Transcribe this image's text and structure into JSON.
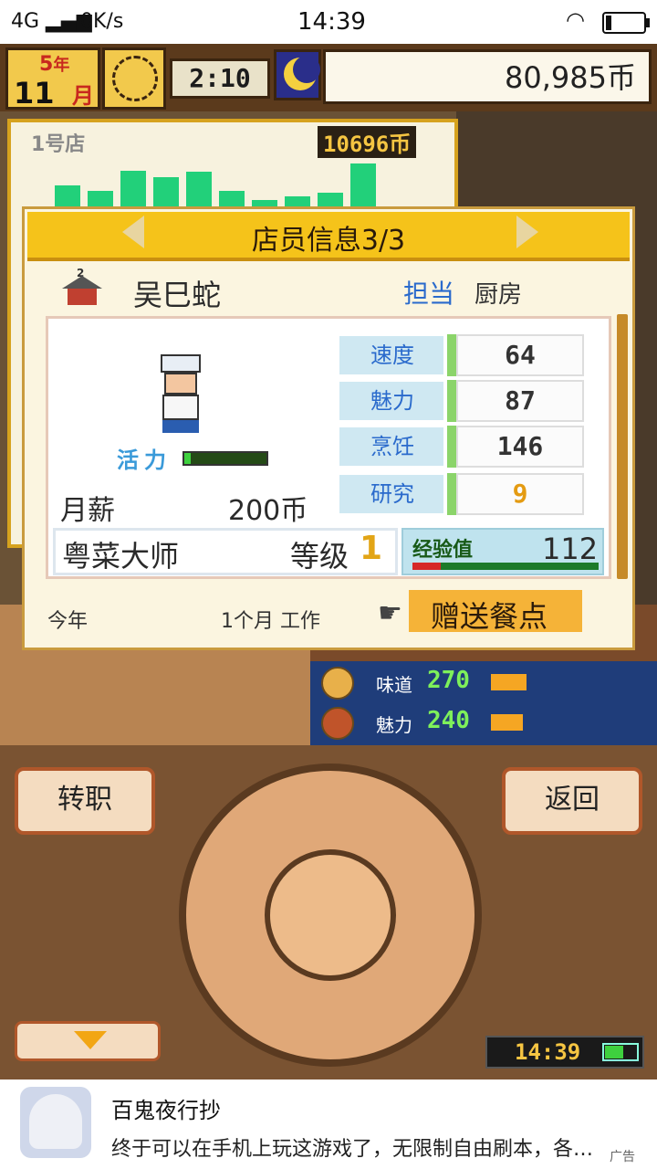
{
  "status_bar": {
    "signal": "4G",
    "net_speed": "0K/s",
    "time": "14:39"
  },
  "hud": {
    "date_month_year_num": "5",
    "date_year_unit": "年",
    "date_month_num": "11",
    "date_month_unit": "月",
    "game_time": "2:10",
    "money": "80,985币"
  },
  "store_panel": {
    "store_label": "1号店",
    "store_value": "10696币",
    "bars": [
      0.45,
      0.35,
      0.72,
      0.6,
      0.7,
      0.35,
      0.18,
      0.25,
      0.32,
      0.85
    ]
  },
  "dialog": {
    "title": "店员信息3/3",
    "store_number": "2",
    "staff_name": "吴巳蛇",
    "role_label": "担当",
    "role_value": "厨房",
    "vital_label": "活力",
    "vital_level": 0.08,
    "salary_label": "月薪",
    "salary_value": "200币",
    "stats": [
      {
        "label": "速度",
        "value": "64"
      },
      {
        "label": "魅力",
        "value": "87"
      },
      {
        "label": "烹饪",
        "value": "146"
      },
      {
        "label": "研究",
        "value": "9"
      }
    ],
    "skill_title": "粤菜大师",
    "level_label": "等级",
    "level_value": "1",
    "exp_label": "经验值",
    "exp_value": "112",
    "exp_progress": 0.15,
    "year_label": "今年",
    "months_label": "1个月  工作",
    "gift_label": "赠送餐点"
  },
  "scene_stats": [
    {
      "label": "味道",
      "value": "270",
      "level": 0.55
    },
    {
      "label": "魅力",
      "value": "240",
      "level": 0.5
    }
  ],
  "controls": {
    "switch_label": "转职",
    "back_label": "返回",
    "mini_clock": "14:39"
  },
  "ad": {
    "title": "百鬼夜行抄",
    "description": "终于可以在手机上玩这游戏了，无限制自由刷本，各…",
    "badge": "广告"
  },
  "colors": {
    "accent_gold": "#f5c31a",
    "money_green": "#22d07a",
    "role_blue": "#2a6acc"
  }
}
